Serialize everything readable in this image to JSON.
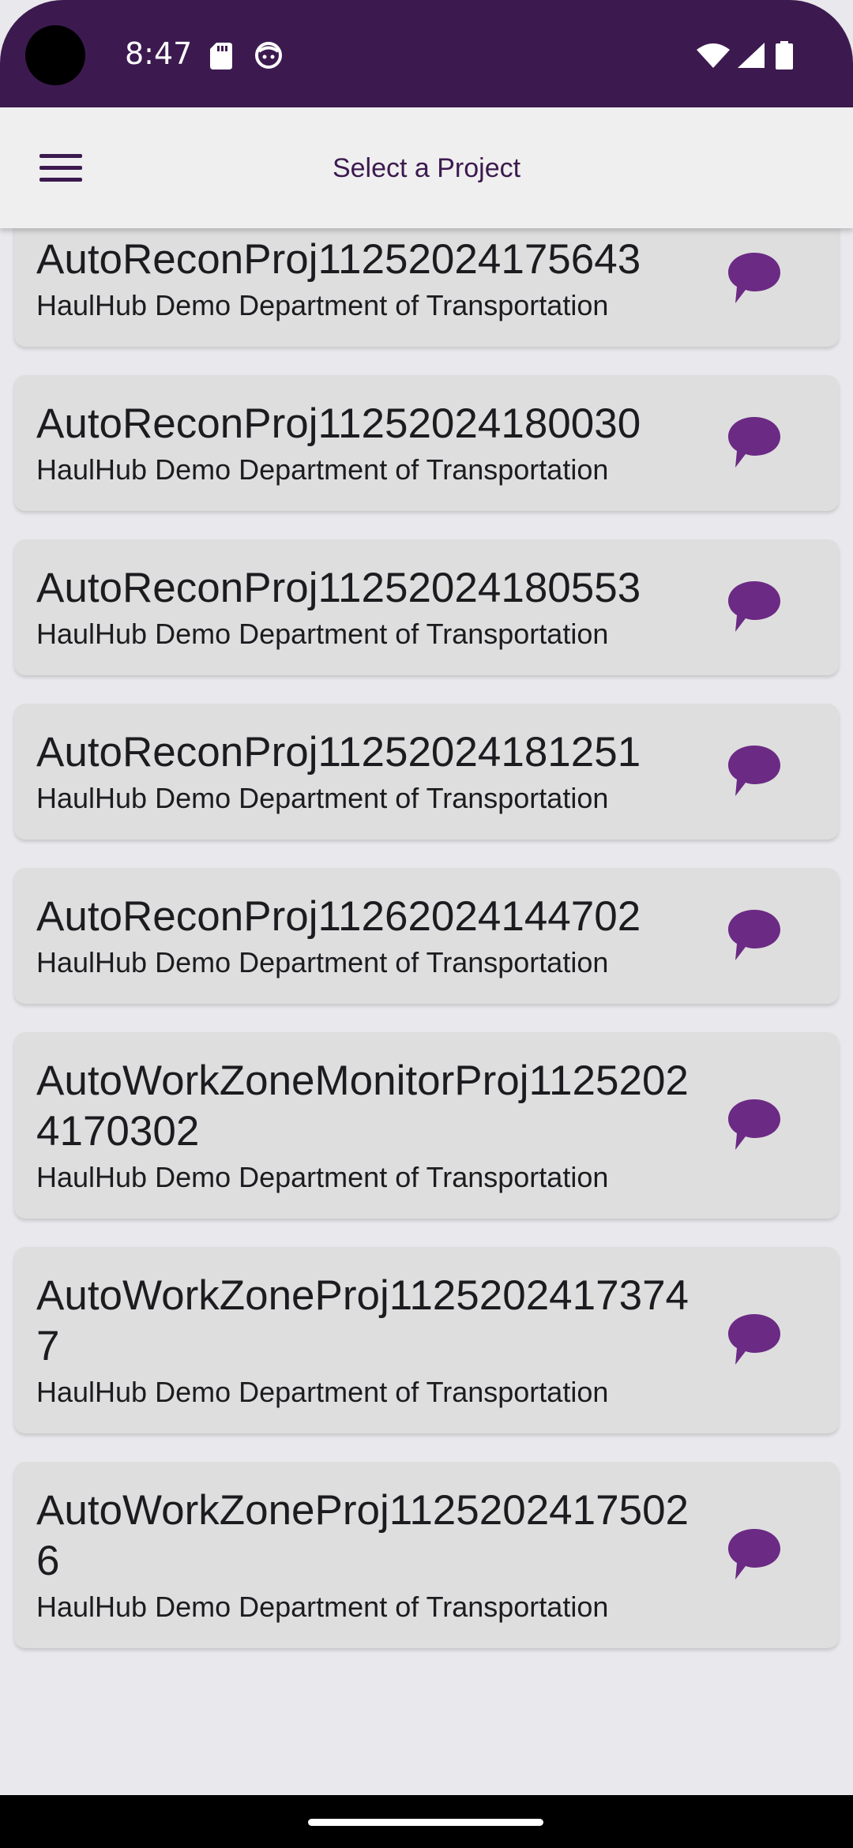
{
  "status_bar": {
    "time": "8:47",
    "icons": [
      "sd-card-icon",
      "face-icon",
      "wifi-icon",
      "signal-icon",
      "battery-icon"
    ]
  },
  "app_bar": {
    "title": "Select a Project",
    "menu_icon": "hamburger-menu-icon"
  },
  "colors": {
    "status_bar_bg": "#3c1a4f",
    "accent": "#6b2a84",
    "card_bg": "#dedede",
    "page_bg": "#e9e8ec"
  },
  "projects": [
    {
      "name": "AutoReconProj11252024175643",
      "org": "HaulHub Demo Department of Transportation"
    },
    {
      "name": "AutoReconProj11252024180030",
      "org": "HaulHub Demo Department of Transportation"
    },
    {
      "name": "AutoReconProj11252024180553",
      "org": "HaulHub Demo Department of Transportation"
    },
    {
      "name": "AutoReconProj11252024181251",
      "org": "HaulHub Demo Department of Transportation"
    },
    {
      "name": "AutoReconProj11262024144702",
      "org": "HaulHub Demo Department of Transportation"
    },
    {
      "name": "AutoWorkZoneMonitorProj11252024170302",
      "org": "HaulHub Demo Department of Transportation"
    },
    {
      "name": "AutoWorkZoneProj11252024173747",
      "org": "HaulHub Demo Department of Transportation"
    },
    {
      "name": "AutoWorkZoneProj11252024175026",
      "org": "HaulHub Demo Department of Transportation"
    }
  ]
}
